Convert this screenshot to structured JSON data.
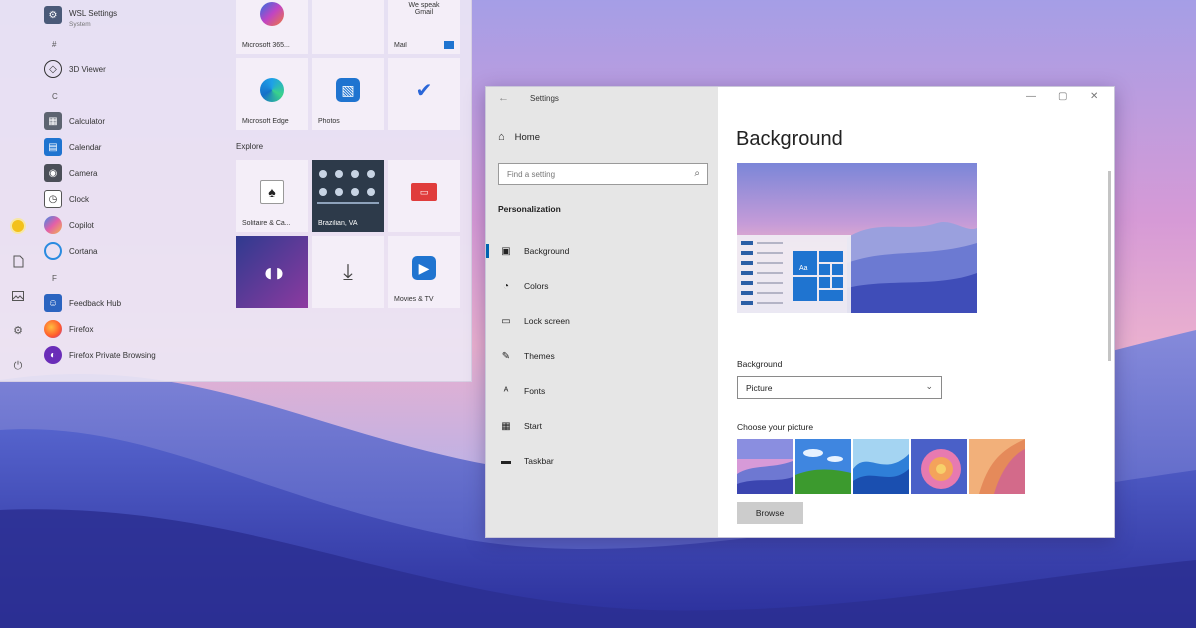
{
  "colors": {
    "accent": "#0063b1",
    "nav_bg": "#e6e6e6",
    "tile_blue": "#1f74d0"
  },
  "start_menu": {
    "rail": [
      {
        "icon": "user-avatar-icon"
      },
      {
        "icon": "document-icon"
      },
      {
        "icon": "pictures-icon"
      },
      {
        "icon": "gear-icon"
      },
      {
        "icon": "power-icon"
      }
    ],
    "apps": [
      {
        "label": "WSL Settings",
        "sub": "System",
        "icon": "wsl-settings-icon"
      },
      {
        "letter": "#"
      },
      {
        "label": "3D Viewer",
        "icon": "3d-viewer-icon"
      },
      {
        "letter": "C"
      },
      {
        "label": "Calculator",
        "icon": "calculator-icon"
      },
      {
        "label": "Calendar",
        "icon": "calendar-icon"
      },
      {
        "label": "Camera",
        "icon": "camera-icon"
      },
      {
        "label": "Clock",
        "icon": "clock-icon"
      },
      {
        "label": "Copilot",
        "icon": "copilot-icon"
      },
      {
        "label": "Cortana",
        "icon": "cortana-icon"
      },
      {
        "letter": "F"
      },
      {
        "label": "Feedback Hub",
        "icon": "feedback-hub-icon"
      },
      {
        "label": "Firefox",
        "icon": "firefox-icon"
      },
      {
        "label": "Firefox Private Browsing",
        "icon": "firefox-private-icon"
      }
    ],
    "tiles": {
      "microsoft365": "Microsoft 365...",
      "mail_text": "We speak Gmail",
      "mail": "Mail",
      "edge": "Microsoft Edge",
      "photos": "Photos",
      "explore": "Explore",
      "solitaire": "Solitaire & Ca...",
      "weather": "Brazilian, VA",
      "movies": "Movies & TV"
    }
  },
  "settings": {
    "window_title": "Settings",
    "home": "Home",
    "search_placeholder": "Find a setting",
    "section": "Personalization",
    "nav": [
      {
        "label": "Background",
        "icon": "picture-icon",
        "active": true
      },
      {
        "label": "Colors",
        "icon": "palette-icon"
      },
      {
        "label": "Lock screen",
        "icon": "lock-screen-icon"
      },
      {
        "label": "Themes",
        "icon": "themes-icon"
      },
      {
        "label": "Fonts",
        "icon": "fonts-icon"
      },
      {
        "label": "Start",
        "icon": "start-icon"
      },
      {
        "label": "Taskbar",
        "icon": "taskbar-icon"
      }
    ],
    "page_title": "Background",
    "preview_text": "Aa",
    "background_label": "Background",
    "background_value": "Picture",
    "choose_label": "Choose your picture",
    "browse": "Browse"
  }
}
